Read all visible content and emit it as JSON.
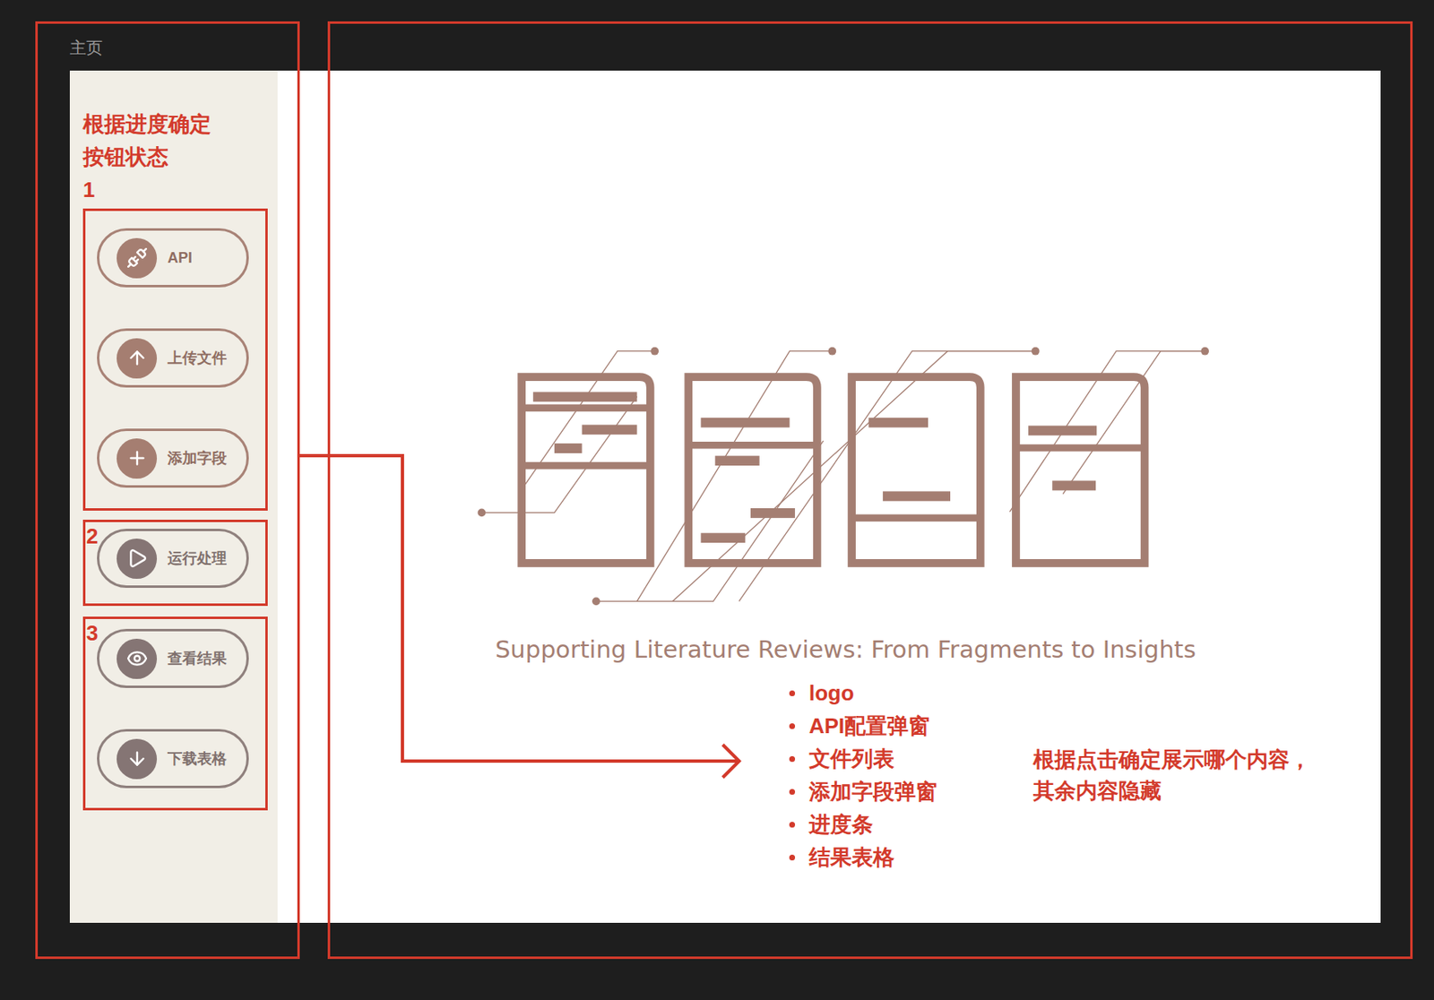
{
  "frame": {
    "title": "主页"
  },
  "sidebar": {
    "note_lines": [
      "根据进度确定",
      "按钮状态"
    ],
    "groups": [
      {
        "label": "1",
        "buttons": [
          {
            "label": "API",
            "kind": "api",
            "disabled": false
          },
          {
            "label": "上传文件",
            "kind": "upload",
            "disabled": false
          },
          {
            "label": "添加字段",
            "kind": "add",
            "disabled": false
          }
        ]
      },
      {
        "label": "2",
        "buttons": [
          {
            "label": "运行处理",
            "kind": "run",
            "disabled": true
          }
        ]
      },
      {
        "label": "3",
        "buttons": [
          {
            "label": "查看结果",
            "kind": "view",
            "disabled": true
          },
          {
            "label": "下载表格",
            "kind": "download",
            "disabled": true
          }
        ]
      }
    ]
  },
  "main": {
    "tagline": "Supporting Literature Reviews: From Fragments to Insights"
  },
  "annotation": {
    "bullets": [
      "logo",
      "API配置弹窗",
      "文件列表",
      "添加字段弹窗",
      "进度条",
      "结果表格"
    ],
    "note_lines": [
      "根据点击确定展示哪个内容，",
      "其余内容隐藏"
    ]
  }
}
